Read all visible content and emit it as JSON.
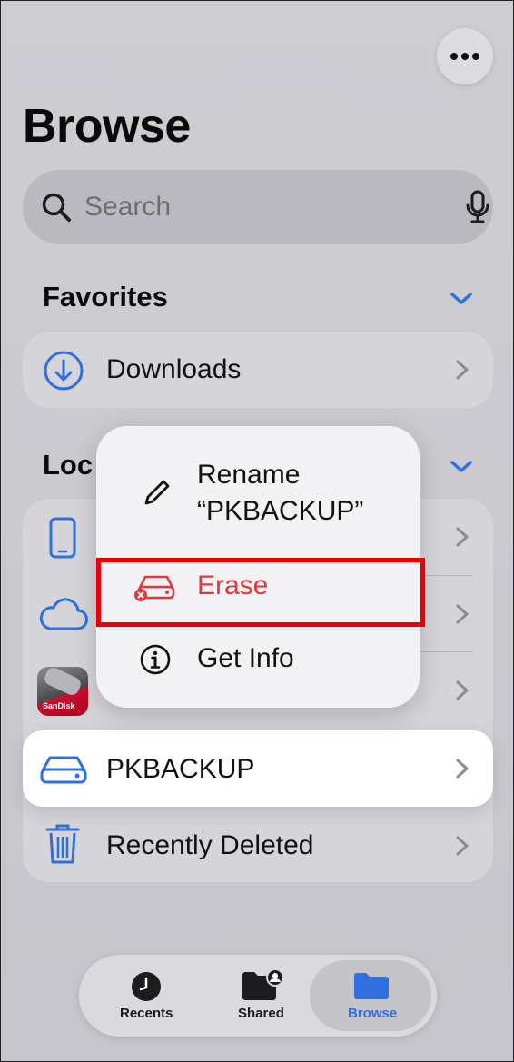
{
  "header": {
    "more_icon": "ellipsis-icon",
    "title": "Browse"
  },
  "search": {
    "placeholder": "Search",
    "search_icon": "magnifier-icon",
    "mic_icon": "microphone-icon"
  },
  "favorites": {
    "title": "Favorites",
    "items": [
      {
        "label": "Downloads",
        "icon": "download-circle-icon"
      }
    ]
  },
  "locations": {
    "title": "Loc",
    "items": [
      {
        "label": "",
        "icon": "iphone-icon"
      },
      {
        "label": "",
        "icon": "icloud-icon"
      },
      {
        "label": "",
        "icon": "sandisk-app-icon"
      },
      {
        "label": "PKBACKUP",
        "icon": "drive-icon"
      },
      {
        "label": "Recently Deleted",
        "icon": "trash-icon"
      }
    ]
  },
  "context_menu": {
    "items": [
      {
        "label": "Rename\n“PKBACKUP”",
        "icon": "pencil-icon"
      },
      {
        "label": "Erase",
        "icon": "erase-drive-icon",
        "color": "#e0383e"
      },
      {
        "label": "Get Info",
        "icon": "info-circle-icon"
      }
    ]
  },
  "tabbar": {
    "tabs": [
      {
        "label": "Recents",
        "icon": "clock-icon",
        "active": false
      },
      {
        "label": "Shared",
        "icon": "shared-folder-icon",
        "active": false
      },
      {
        "label": "Browse",
        "icon": "folder-icon",
        "active": true
      }
    ]
  },
  "colors": {
    "accent": "#2f6fe0",
    "destructive": "#e0383e",
    "highlight_box": "#ee0000"
  }
}
